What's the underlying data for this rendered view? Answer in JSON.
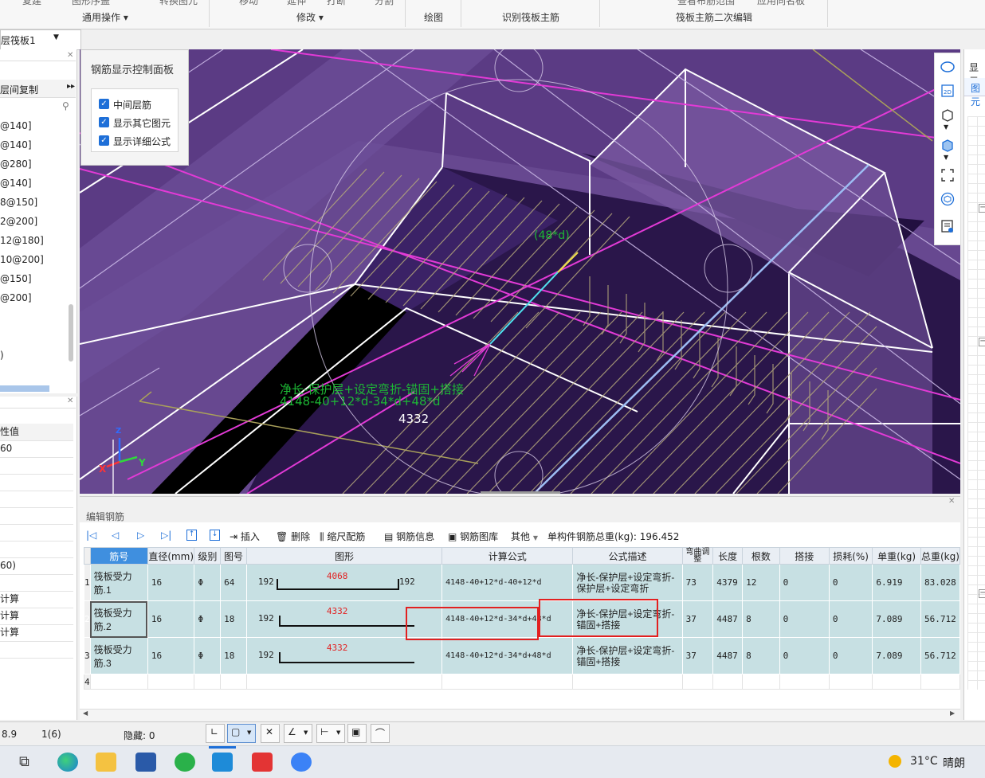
{
  "ribbon": {
    "groups": [
      "通用操作",
      "修改",
      "绘图",
      "识别筏板主筋",
      "筏板主筋二次编辑"
    ],
    "cut_top": [
      "复建",
      "图形序盖",
      "转换图元",
      "移动",
      "延伸",
      "打断",
      "分割",
      "查看布筋范围",
      "应用同名板"
    ]
  },
  "floor_select": "层筏板1",
  "left_panel": {
    "header": "层间复制",
    "items": [
      "@140]",
      "@140]",
      "@280]",
      "@140]",
      "8@150]",
      "2@200]",
      "12@180]",
      "10@200]",
      "@150]",
      "@200]",
      ")"
    ]
  },
  "prop_panel": {
    "header": "性值",
    "rows": [
      "60",
      "",
      "",
      "",
      "",
      "",
      "",
      "60)",
      "",
      "计算",
      "计算",
      "计算",
      ""
    ]
  },
  "control_panel": {
    "title": "钢筋显示控制面板",
    "options": [
      "中间层筋",
      "显示其它图元",
      "显示详细公式"
    ]
  },
  "viewport": {
    "label_48d": "(48*d)",
    "formula_desc": "净长-保护层+设定弯折-锚固+搭接",
    "formula": "4148-40+12*d-34*d+48*d",
    "length": "4332",
    "axis_x": "X",
    "axis_y": "Y",
    "axis_z": "Z"
  },
  "editor": {
    "title": "编辑钢筋",
    "toolbar": {
      "insert": "插入",
      "delete": "删除",
      "scale": "缩尺配筋",
      "info": "钢筋信息",
      "library": "钢筋图库",
      "other": "其他",
      "total": "单构件钢筋总重(kg): 196.452"
    },
    "columns": [
      "筋号",
      "直径(mm)",
      "级别",
      "图号",
      "图形",
      "计算公式",
      "公式描述",
      "弯曲调整",
      "长度",
      "根数",
      "搭接",
      "损耗(%)",
      "单重(kg)",
      "总重(kg)"
    ],
    "rows": [
      {
        "no": "1",
        "name": "筏板受力筋.1",
        "dia": "16",
        "grade": "Φ",
        "fig": "64",
        "left": "192",
        "mid": "4068",
        "right": "192",
        "formula": "4148-40+12*d-40+12*d",
        "desc": "净长-保护层+设定弯折-保护层+设定弯折",
        "bend": "73",
        "len": "4379",
        "count": "12",
        "lap": "0",
        "loss": "0",
        "unit": "6.919",
        "total": "83.028"
      },
      {
        "no": "2",
        "name": "筏板受力筋.2",
        "dia": "16",
        "grade": "Φ",
        "fig": "18",
        "left": "192",
        "mid": "4332",
        "right": "",
        "formula": "4148-40+12*d-34*d+48*d",
        "desc": "净长-保护层+设定弯折-锚固+搭接",
        "bend": "37",
        "len": "4487",
        "count": "8",
        "lap": "0",
        "loss": "0",
        "unit": "7.089",
        "total": "56.712"
      },
      {
        "no": "3",
        "name": "筏板受力筋.3",
        "dia": "16",
        "grade": "Φ",
        "fig": "18",
        "left": "192",
        "mid": "4332",
        "right": "",
        "formula": "4148-40+12*d-34*d+48*d",
        "desc": "净长-保护层+设定弯折-锚固+搭接",
        "bend": "37",
        "len": "4487",
        "count": "8",
        "lap": "0",
        "loss": "0",
        "unit": "7.089",
        "total": "56.712"
      }
    ],
    "empty_row_no": "4"
  },
  "status": {
    "v1": "8.9",
    "v2": "1(6)",
    "hidden": "隐藏: 0"
  },
  "taskbar": {
    "temp": "31°C",
    "weather": "晴朗"
  },
  "right_panel": {
    "tab1": "显示",
    "tab2": "图元"
  }
}
